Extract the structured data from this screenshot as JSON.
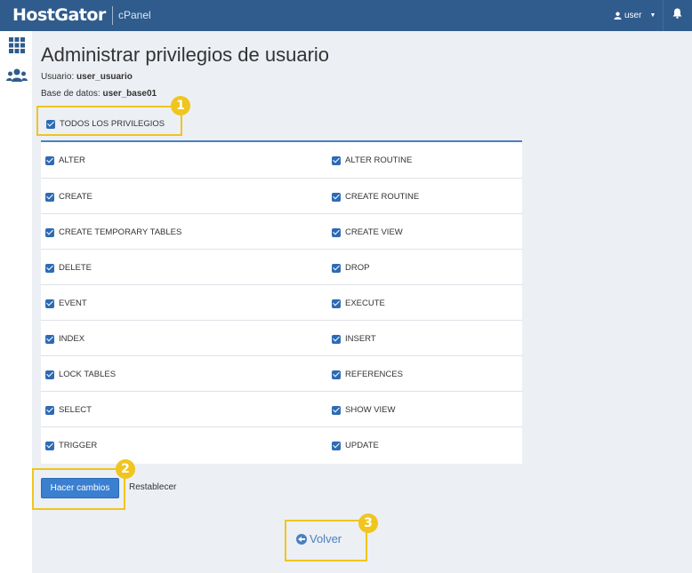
{
  "header": {
    "brand": "HostGator",
    "product": "cPanel",
    "user_label": "user"
  },
  "page": {
    "title": "Administrar privilegios de usuario",
    "user_label": "Usuario:",
    "user_value": "user_usuario",
    "db_label": "Base de datos:",
    "db_value": "user_base01",
    "all_privileges": "TODOS LOS PRIVILEGIOS"
  },
  "privileges": [
    [
      "ALTER",
      "ALTER ROUTINE"
    ],
    [
      "CREATE",
      "CREATE ROUTINE"
    ],
    [
      "CREATE TEMPORARY TABLES",
      "CREATE VIEW"
    ],
    [
      "DELETE",
      "DROP"
    ],
    [
      "EVENT",
      "EXECUTE"
    ],
    [
      "INDEX",
      "INSERT"
    ],
    [
      "LOCK TABLES",
      "REFERENCES"
    ],
    [
      "SELECT",
      "SHOW VIEW"
    ],
    [
      "TRIGGER",
      "UPDATE"
    ]
  ],
  "actions": {
    "save": "Hacer cambios",
    "reset": "Restablecer",
    "back": "Volver"
  },
  "callouts": [
    "1",
    "2",
    "3"
  ],
  "colors": {
    "header": "#2f5c8c",
    "accent": "#3a7fd0",
    "highlight": "#f0c51e"
  }
}
